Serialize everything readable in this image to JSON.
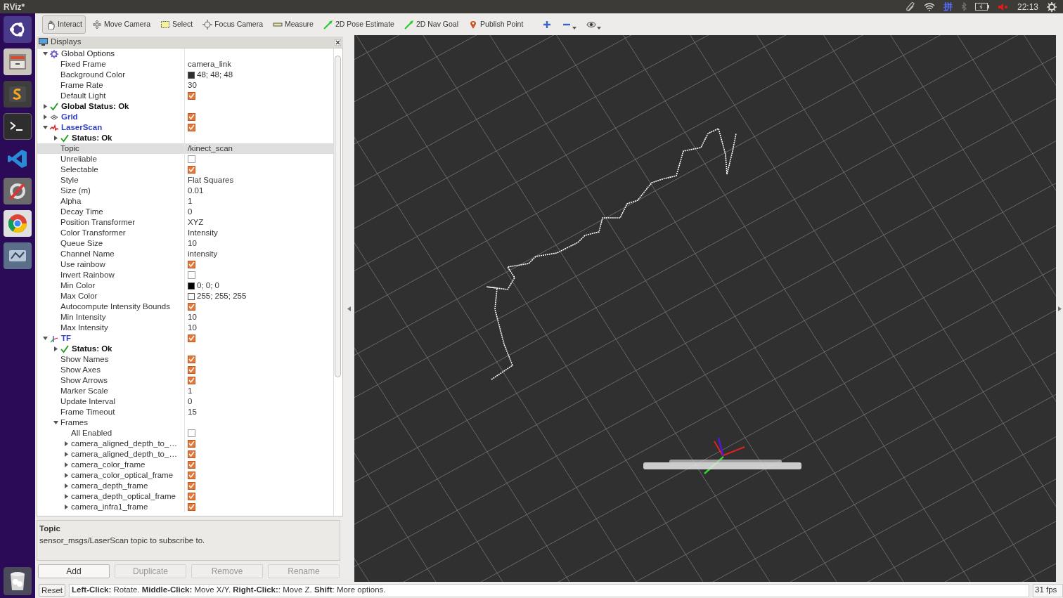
{
  "window": {
    "title": "RViz*"
  },
  "tray": {
    "input_method": "拼",
    "time": "22:13"
  },
  "toolbar": [
    {
      "label": "Interact",
      "kind": "interact",
      "selected": true
    },
    {
      "label": "Move Camera",
      "kind": "move",
      "selected": false
    },
    {
      "label": "Select",
      "kind": "select",
      "selected": false
    },
    {
      "label": "Focus Camera",
      "kind": "focus",
      "selected": false
    },
    {
      "label": "Measure",
      "kind": "measure",
      "selected": false
    },
    {
      "label": "2D Pose Estimate",
      "kind": "pose",
      "selected": false
    },
    {
      "label": "2D Nav Goal",
      "kind": "nav",
      "selected": false
    },
    {
      "label": "Publish Point",
      "kind": "point",
      "selected": false
    }
  ],
  "displays": {
    "title": "Displays",
    "items": [
      {
        "label": "Global Options",
        "kind": "options",
        "expanded": true,
        "selected": false,
        "children": [
          {
            "label": "Fixed Frame",
            "kind": "property",
            "value": "camera_link",
            "selected": false
          },
          {
            "label": "Background Color",
            "kind": "property",
            "value": "48; 48; 48",
            "color": "#303030",
            "selected": false
          },
          {
            "label": "Frame Rate",
            "kind": "property",
            "value": "30",
            "selected": false
          },
          {
            "label": "Default Light",
            "kind": "property",
            "checked": true,
            "selected": false
          }
        ]
      },
      {
        "label": "Global Status: Ok",
        "kind": "status",
        "expanded": false,
        "selected": false
      },
      {
        "label": "Grid",
        "kind": "grid",
        "expanded": false,
        "checked": true,
        "selected": false
      },
      {
        "label": "LaserScan",
        "kind": "laserscan",
        "expanded": true,
        "checked": true,
        "selected": false,
        "children": [
          {
            "label": "Status: Ok",
            "kind": "status",
            "expanded": false,
            "selected": false
          },
          {
            "label": "Topic",
            "kind": "property",
            "value": "/kinect_scan",
            "selected": true
          },
          {
            "label": "Unreliable",
            "kind": "property",
            "checked": false,
            "selected": false
          },
          {
            "label": "Selectable",
            "kind": "property",
            "checked": true,
            "selected": false
          },
          {
            "label": "Style",
            "kind": "property",
            "value": "Flat Squares",
            "selected": false
          },
          {
            "label": "Size (m)",
            "kind": "property",
            "value": "0.01",
            "selected": false
          },
          {
            "label": "Alpha",
            "kind": "property",
            "value": "1",
            "selected": false
          },
          {
            "label": "Decay Time",
            "kind": "property",
            "value": "0",
            "selected": false
          },
          {
            "label": "Position Transformer",
            "kind": "property",
            "value": "XYZ",
            "selected": false
          },
          {
            "label": "Color Transformer",
            "kind": "property",
            "value": "Intensity",
            "selected": false
          },
          {
            "label": "Queue Size",
            "kind": "property",
            "value": "10",
            "selected": false
          },
          {
            "label": "Channel Name",
            "kind": "property",
            "value": "intensity",
            "selected": false
          },
          {
            "label": "Use rainbow",
            "kind": "property",
            "checked": true,
            "selected": false
          },
          {
            "label": "Invert Rainbow",
            "kind": "property",
            "checked": false,
            "selected": false
          },
          {
            "label": "Min Color",
            "kind": "property",
            "value": "0; 0; 0",
            "color": "#000000",
            "selected": false
          },
          {
            "label": "Max Color",
            "kind": "property",
            "value": "255; 255; 255",
            "color": "#ffffff",
            "selected": false
          },
          {
            "label": "Autocompute Intensity Bounds",
            "kind": "property",
            "checked": true,
            "selected": false
          },
          {
            "label": "Min Intensity",
            "kind": "property",
            "value": "10",
            "selected": false
          },
          {
            "label": "Max Intensity",
            "kind": "property",
            "value": "10",
            "selected": false
          }
        ]
      },
      {
        "label": "TF",
        "kind": "tf",
        "expanded": true,
        "checked": true,
        "selected": false,
        "children": [
          {
            "label": "Status: Ok",
            "kind": "status",
            "expanded": false,
            "selected": false
          },
          {
            "label": "Show Names",
            "kind": "property",
            "checked": true,
            "selected": false
          },
          {
            "label": "Show Axes",
            "kind": "property",
            "checked": true,
            "selected": false
          },
          {
            "label": "Show Arrows",
            "kind": "property",
            "checked": true,
            "selected": false
          },
          {
            "label": "Marker Scale",
            "kind": "property",
            "value": "1",
            "selected": false
          },
          {
            "label": "Update Interval",
            "kind": "property",
            "value": "0",
            "selected": false
          },
          {
            "label": "Frame Timeout",
            "kind": "property",
            "value": "15",
            "selected": false
          },
          {
            "label": "Frames",
            "kind": "property",
            "expanded": true,
            "selected": false,
            "children": [
              {
                "label": "All Enabled",
                "kind": "property",
                "checked": false,
                "selected": false
              },
              {
                "label": "camera_aligned_depth_to_…",
                "kind": "property",
                "expanded": false,
                "checked": true,
                "selected": false
              },
              {
                "label": "camera_aligned_depth_to_…",
                "kind": "property",
                "expanded": false,
                "checked": true,
                "selected": false
              },
              {
                "label": "camera_color_frame",
                "kind": "property",
                "expanded": false,
                "checked": true,
                "selected": false
              },
              {
                "label": "camera_color_optical_frame",
                "kind": "property",
                "expanded": false,
                "checked": true,
                "selected": false
              },
              {
                "label": "camera_depth_frame",
                "kind": "property",
                "expanded": false,
                "checked": true,
                "selected": false
              },
              {
                "label": "camera_depth_optical_frame",
                "kind": "property",
                "expanded": false,
                "checked": true,
                "selected": false
              },
              {
                "label": "camera_infra1_frame",
                "kind": "property",
                "expanded": false,
                "checked": true,
                "selected": false
              }
            ]
          }
        ]
      }
    ]
  },
  "description": {
    "title": "Topic",
    "text": "sensor_msgs/LaserScan topic to subscribe to."
  },
  "panel_buttons": [
    {
      "label": "Add",
      "disabled": false
    },
    {
      "label": "Duplicate",
      "disabled": true
    },
    {
      "label": "Remove",
      "disabled": true
    },
    {
      "label": "Rename",
      "disabled": true
    }
  ],
  "status_bar": {
    "reset": "Reset",
    "message": "**Left-Click:** Rotate. **Middle-Click:** Move X/Y. **Right-Click:**: Move Z. **Shift**: More options.",
    "fps": "31 fps"
  }
}
